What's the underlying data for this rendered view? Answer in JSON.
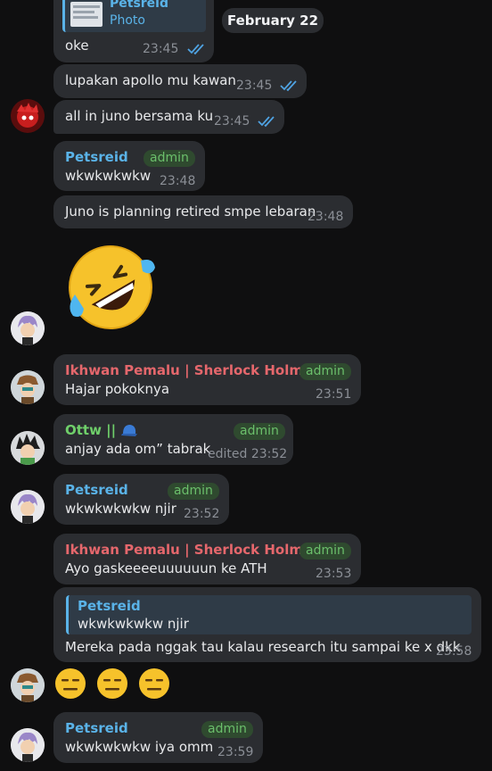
{
  "date_pill": "February 22",
  "colors": {
    "bg": "#0f0f10",
    "bubble": "#2b2d31",
    "blue_name": "#5ab3e8",
    "red_name": "#e5676c",
    "green_name": "#6fcf6a",
    "admin_badge_bg": "#2f4a2f",
    "tick": "#4fa3e3"
  },
  "messages": {
    "m0": {
      "reply_name": "Petsreid",
      "reply_sub": "Photo",
      "text": "oke",
      "time": "23:45"
    },
    "m1": {
      "text": "lupakan apollo mu kawan",
      "time": "23:45"
    },
    "m2": {
      "text": "all in juno bersama ku",
      "time": "23:45"
    },
    "m3": {
      "name": "Petsreid",
      "badge": "admin",
      "text": "wkwkwkwkw",
      "time": "23:48"
    },
    "m4": {
      "text": "Juno is planning retired smpe lebaran",
      "time": "23:48"
    },
    "m5": {
      "emoji": "rolling-on-floor-laughing"
    },
    "m6": {
      "name": "Ikhwan Pemalu | Sherlock Holmes",
      "badge": "admin",
      "text": "Hajar pokoknya",
      "time": "23:51"
    },
    "m7": {
      "name": "Ottw ||",
      "badge": "admin",
      "text": "anjay ada om” tabrak",
      "time": "edited 23:52"
    },
    "m8": {
      "name": "Petsreid",
      "badge": "admin",
      "text": "wkwkwkwkw njir",
      "time": "23:52"
    },
    "m9": {
      "name": "Ikhwan Pemalu | Sherlock Holmes",
      "badge": "admin",
      "text": "Ayo gaskeeeeuuuuuun ke ATH",
      "time": "23:53"
    },
    "m10": {
      "reply_name": "Petsreid",
      "reply_text": "wkwkwkwkw njir",
      "text": "Mereka pada nggak tau kalau research itu sampai ke x dkk",
      "time": "23:58"
    },
    "m11": {
      "emoji": "expressionless-face x3"
    },
    "m12": {
      "name": "Petsreid",
      "badge": "admin",
      "text": "wkwkwkwkw iya omm",
      "time": "23:59"
    }
  }
}
